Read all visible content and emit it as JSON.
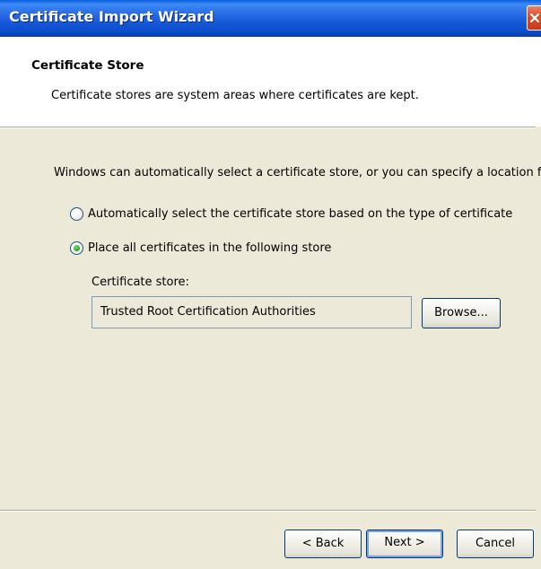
{
  "window": {
    "title": "Certificate Import Wizard",
    "close_icon": "close-icon"
  },
  "header": {
    "title": "Certificate Store",
    "description": "Certificate stores are system areas where certificates are kept."
  },
  "body": {
    "intro": "Windows can automatically select a certificate store, or you can specify a location for",
    "options": [
      {
        "label": "Automatically select the certificate store based on the type of certificate",
        "selected": false
      },
      {
        "label": "Place all certificates in the following store",
        "selected": true
      }
    ],
    "store_label": "Certificate store:",
    "store_value": "Trusted Root Certification Authorities",
    "browse_label": "Browse..."
  },
  "footer": {
    "back_label": "< Back",
    "next_label": "Next >",
    "cancel_label": "Cancel"
  },
  "colors": {
    "titlebar": "#0a5fe0",
    "window_bg": "#ece9d8",
    "close_button": "#d9512e",
    "radio_selected": "#21a121"
  }
}
